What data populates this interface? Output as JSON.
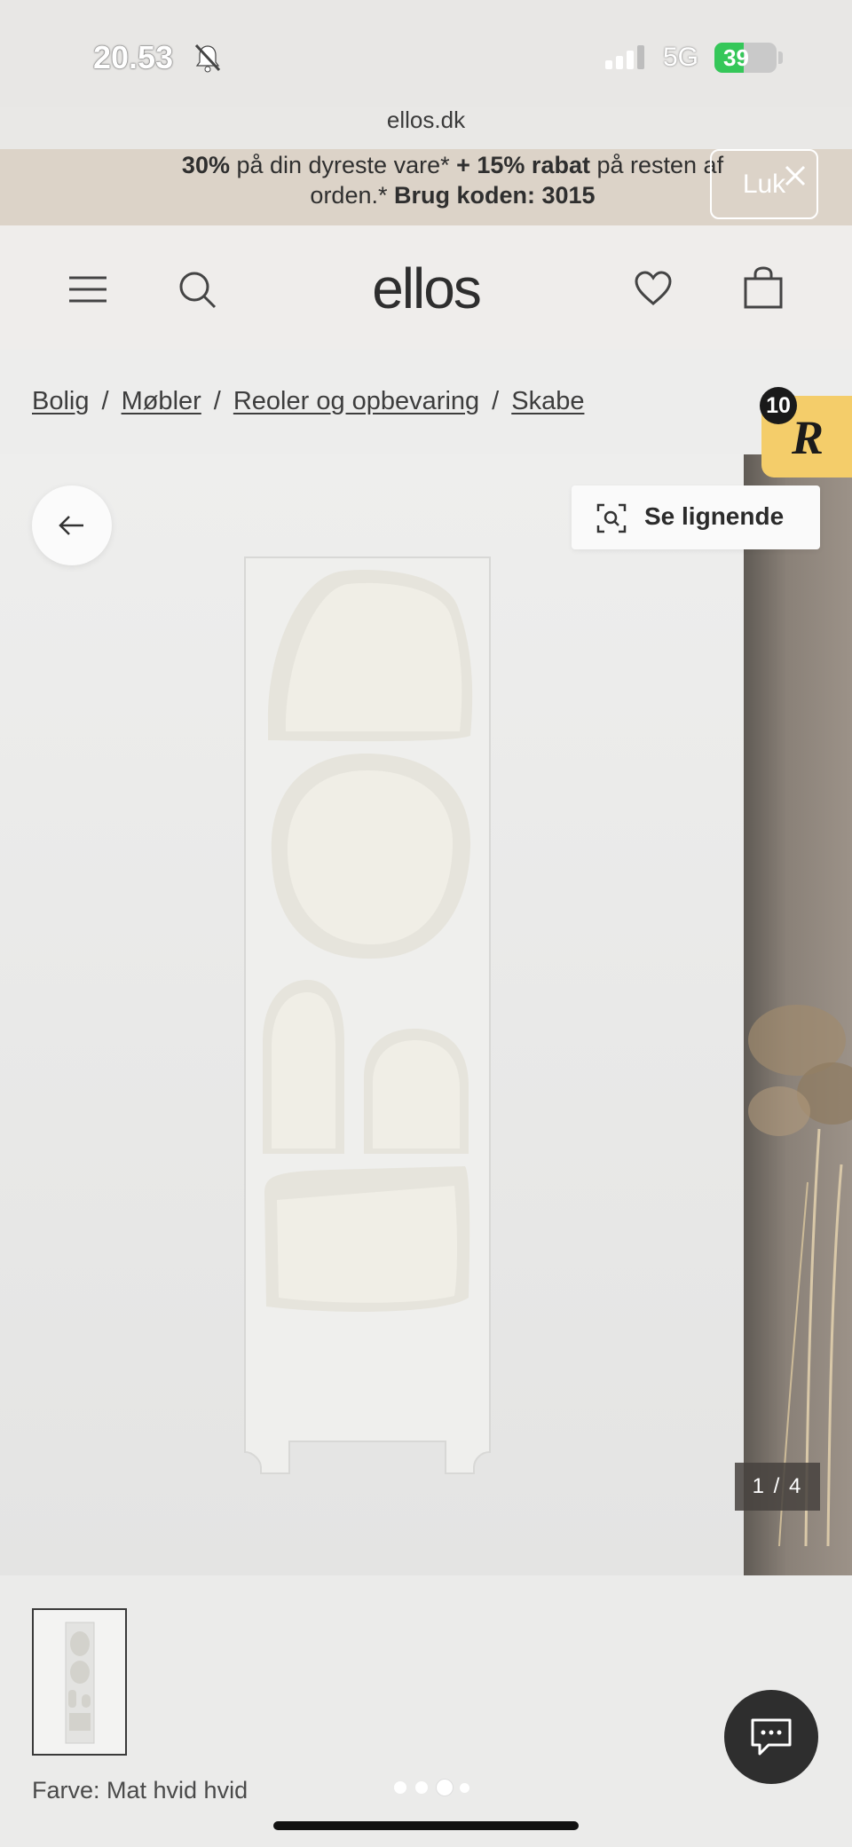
{
  "status_bar": {
    "time": "20.53",
    "network": "5G",
    "battery": "39",
    "battery_level": 0.39,
    "icons": [
      "bell-off-icon",
      "signal-icon",
      "battery-icon"
    ]
  },
  "browser": {
    "url": "ellos.dk"
  },
  "promo": {
    "line1_bold_a": "30%",
    "line1_text_a": " på din dyreste vare* ",
    "line1_bold_b": "+ 15% rabat",
    "line1_text_b": " på resten af",
    "line2_text": "orden.* ",
    "line2_bold": "Brug koden: 3015",
    "close_label": "Luk"
  },
  "header": {
    "logo": "ellos",
    "icons": [
      "menu-icon",
      "search-icon",
      "heart-icon",
      "bag-icon"
    ]
  },
  "breadcrumb": {
    "items": [
      "Bolig",
      "Møbler",
      "Reoler og opbevaring",
      "Skabe"
    ],
    "separator": "/"
  },
  "badge": {
    "count": "10",
    "letter": "R",
    "color": "#f4cd6a"
  },
  "gallery": {
    "similar_label": "Se lignende",
    "counter": "1 / 4",
    "current_index": 1,
    "total": 4,
    "dots_count": 4,
    "active_dot": 2
  },
  "product": {
    "color_label": "Farve: Mat hvid hvid"
  },
  "colors": {
    "promo_bg": "#dcd3c8",
    "header_bg": "#efedeb",
    "badge": "#f4cd6a",
    "battery": "#35c759",
    "chat_button": "#2e2e2e"
  }
}
